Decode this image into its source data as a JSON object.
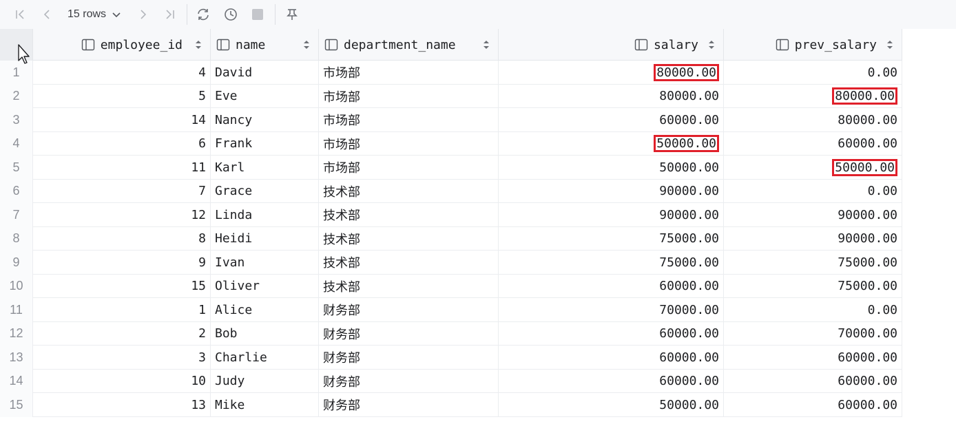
{
  "toolbar": {
    "rows_label": "15 rows",
    "icons": [
      "first-page-icon",
      "prev-page-icon",
      "chevron-down-icon",
      "next-page-icon",
      "last-page-icon",
      "refresh-icon",
      "history-icon",
      "stop-icon",
      "pin-icon"
    ]
  },
  "columns": [
    {
      "label": "employee_id"
    },
    {
      "label": "name"
    },
    {
      "label": "department_name"
    },
    {
      "label": "salary"
    },
    {
      "label": "prev_salary"
    }
  ],
  "rows": [
    {
      "n": "1",
      "id": "4",
      "name": "David",
      "dept": "市场部",
      "salary": "80000.00",
      "prev": "0.00",
      "hl_salary": true,
      "hl_prev": false
    },
    {
      "n": "2",
      "id": "5",
      "name": "Eve",
      "dept": "市场部",
      "salary": "80000.00",
      "prev": "80000.00",
      "hl_salary": false,
      "hl_prev": true
    },
    {
      "n": "3",
      "id": "14",
      "name": "Nancy",
      "dept": "市场部",
      "salary": "60000.00",
      "prev": "80000.00",
      "hl_salary": false,
      "hl_prev": false
    },
    {
      "n": "4",
      "id": "6",
      "name": "Frank",
      "dept": "市场部",
      "salary": "50000.00",
      "prev": "60000.00",
      "hl_salary": true,
      "hl_prev": false
    },
    {
      "n": "5",
      "id": "11",
      "name": "Karl",
      "dept": "市场部",
      "salary": "50000.00",
      "prev": "50000.00",
      "hl_salary": false,
      "hl_prev": true
    },
    {
      "n": "6",
      "id": "7",
      "name": "Grace",
      "dept": "技术部",
      "salary": "90000.00",
      "prev": "0.00",
      "hl_salary": false,
      "hl_prev": false
    },
    {
      "n": "7",
      "id": "12",
      "name": "Linda",
      "dept": "技术部",
      "salary": "90000.00",
      "prev": "90000.00",
      "hl_salary": false,
      "hl_prev": false
    },
    {
      "n": "8",
      "id": "8",
      "name": "Heidi",
      "dept": "技术部",
      "salary": "75000.00",
      "prev": "90000.00",
      "hl_salary": false,
      "hl_prev": false
    },
    {
      "n": "9",
      "id": "9",
      "name": "Ivan",
      "dept": "技术部",
      "salary": "75000.00",
      "prev": "75000.00",
      "hl_salary": false,
      "hl_prev": false
    },
    {
      "n": "10",
      "id": "15",
      "name": "Oliver",
      "dept": "技术部",
      "salary": "60000.00",
      "prev": "75000.00",
      "hl_salary": false,
      "hl_prev": false
    },
    {
      "n": "11",
      "id": "1",
      "name": "Alice",
      "dept": "财务部",
      "salary": "70000.00",
      "prev": "0.00",
      "hl_salary": false,
      "hl_prev": false
    },
    {
      "n": "12",
      "id": "2",
      "name": "Bob",
      "dept": "财务部",
      "salary": "60000.00",
      "prev": "70000.00",
      "hl_salary": false,
      "hl_prev": false
    },
    {
      "n": "13",
      "id": "3",
      "name": "Charlie",
      "dept": "财务部",
      "salary": "60000.00",
      "prev": "60000.00",
      "hl_salary": false,
      "hl_prev": false
    },
    {
      "n": "14",
      "id": "10",
      "name": "Judy",
      "dept": "财务部",
      "salary": "60000.00",
      "prev": "60000.00",
      "hl_salary": false,
      "hl_prev": false
    },
    {
      "n": "15",
      "id": "13",
      "name": "Mike",
      "dept": "财务部",
      "salary": "50000.00",
      "prev": "60000.00",
      "hl_salary": false,
      "hl_prev": false
    }
  ],
  "colors": {
    "highlight": "#e0202a",
    "icon": "#8c8f96",
    "icon_active": "#6c6f75"
  }
}
